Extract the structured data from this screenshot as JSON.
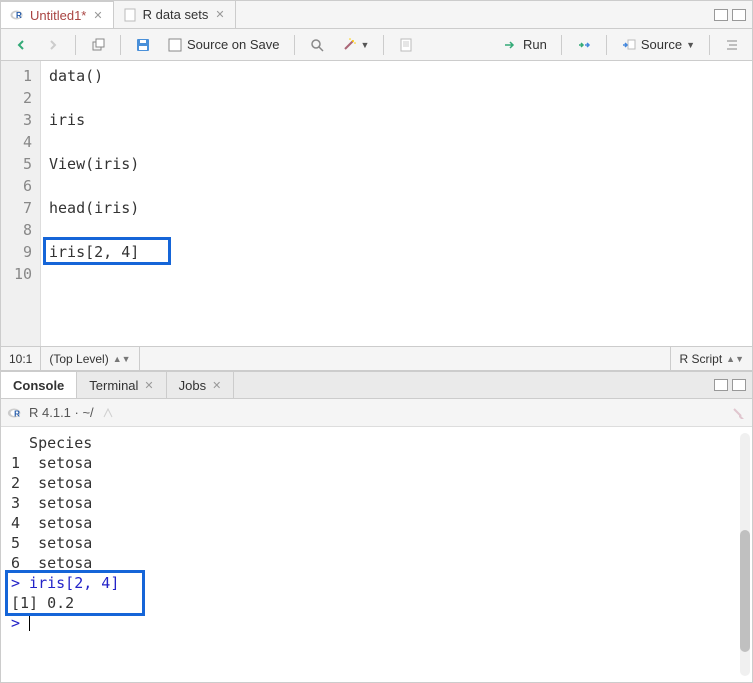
{
  "editor_pane": {
    "tabs": [
      {
        "label": "Untitled1*",
        "icon": "r-logo",
        "active": true,
        "unsaved": true
      },
      {
        "label": "R data sets",
        "icon": "doc",
        "active": false,
        "unsaved": false
      }
    ],
    "toolbar": {
      "source_on_save": "Source on Save",
      "run": "Run",
      "source": "Source"
    },
    "code_lines": [
      "data()",
      "",
      "iris",
      "",
      "View(iris)",
      "",
      "head(iris)",
      "",
      "iris[2, 4]",
      ""
    ],
    "highlight_line_index": 8,
    "statusbar": {
      "pos": "10:1",
      "scope": "(Top Level)",
      "lang": "R Script"
    }
  },
  "console_pane": {
    "tabs": [
      {
        "label": "Console",
        "active": true
      },
      {
        "label": "Terminal",
        "active": false
      },
      {
        "label": "Jobs",
        "active": false
      }
    ],
    "header": "R 4.1.1 · ~/",
    "lines": [
      {
        "t": "  Species",
        "p": false
      },
      {
        "t": "1  setosa",
        "p": false
      },
      {
        "t": "2  setosa",
        "p": false
      },
      {
        "t": "3  setosa",
        "p": false
      },
      {
        "t": "4  setosa",
        "p": false
      },
      {
        "t": "5  setosa",
        "p": false
      },
      {
        "t": "6  setosa",
        "p": false
      },
      {
        "t": "> iris[2, 4]",
        "p": true
      },
      {
        "t": "[1] 0.2",
        "p": false
      },
      {
        "t": "> ",
        "p": true,
        "cursor": true
      }
    ],
    "highlight_start": 7,
    "highlight_end": 8
  }
}
